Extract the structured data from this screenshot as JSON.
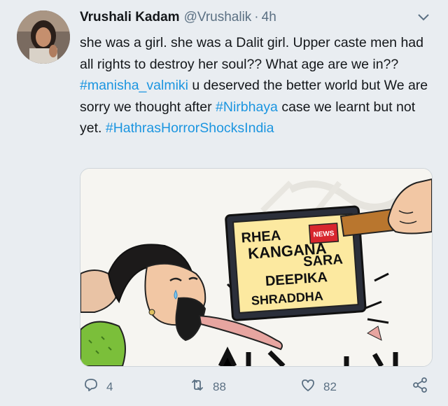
{
  "tweet": {
    "author_name": "Vrushali Kadam",
    "handle": "@Vrushalik",
    "separator": "·",
    "time": "4h",
    "text_parts": [
      "she was a girl. she was a Dalit girl. Upper caste men had all rights to destroy her soul?? What age are we in?? ",
      "#manisha_valmiki",
      " u deserved the better world but We are sorry we thought after ",
      "#Nirbhaya",
      " case we learnt but not yet. ",
      "#HathrasHorrorShocksIndia"
    ],
    "hashtag_color": "#1b95e0"
  },
  "cartoon": {
    "book_lines": [
      "RHEA",
      "KANGANA",
      "SARA",
      "DEEPIKA",
      "SHRADDHA"
    ],
    "news_badge": "NEWS"
  },
  "actions": {
    "reply_count": "4",
    "retweet_count": "88",
    "like_count": "82",
    "icons": [
      "reply-icon",
      "retweet-icon",
      "like-icon",
      "share-icon"
    ]
  }
}
